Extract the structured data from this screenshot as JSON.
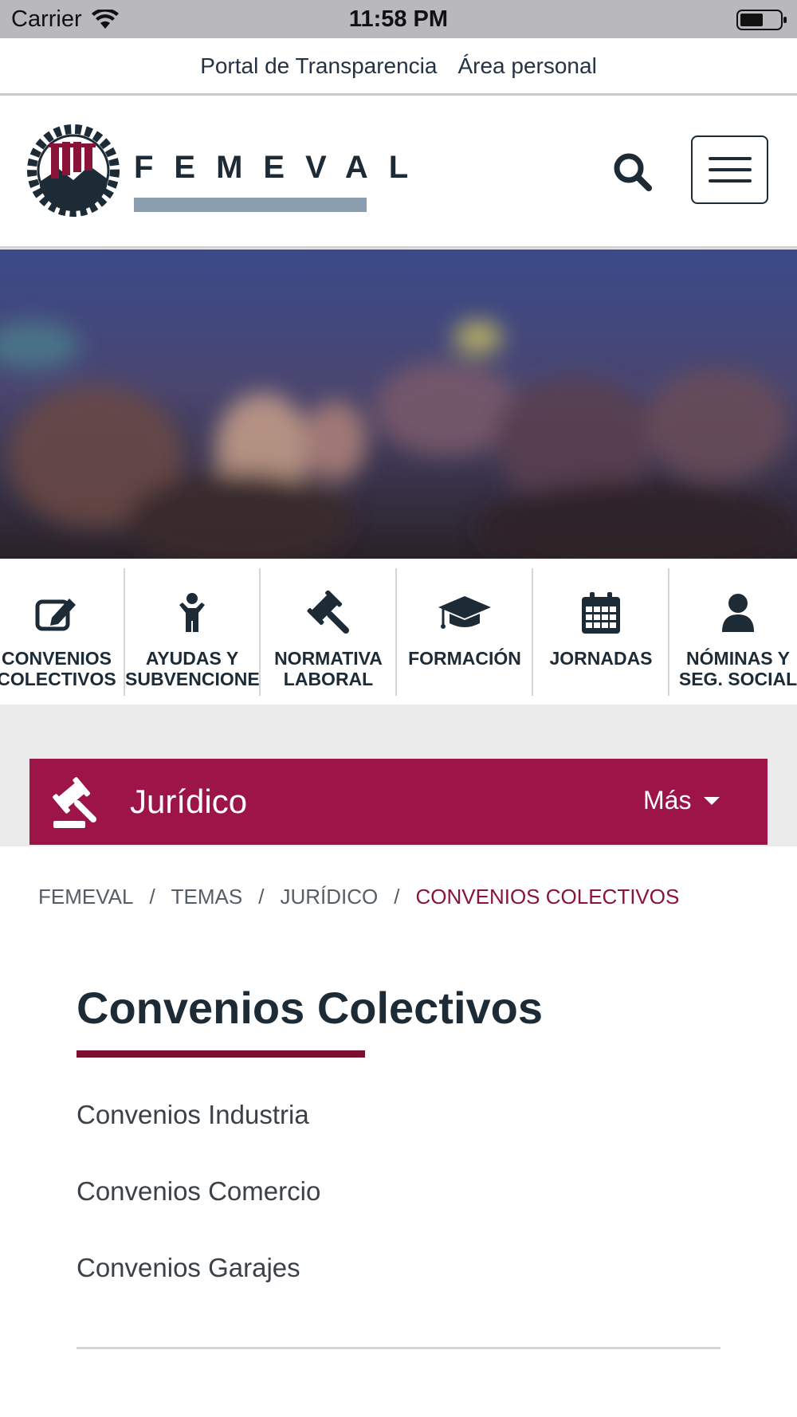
{
  "status_bar": {
    "carrier": "Carrier",
    "time": "11:58 PM"
  },
  "top_links": {
    "transparency": "Portal de Transparencia",
    "personal_area": "Área personal"
  },
  "header": {
    "logo_text": "FEMEVAL",
    "icons": [
      "search-icon",
      "hamburger-menu-icon"
    ]
  },
  "categories": [
    {
      "line1": "CONVENIOS",
      "line2": "COLECTIVOS",
      "icon": "edit-icon"
    },
    {
      "line1": "AYUDAS Y",
      "line2": "SUBVENCIONES",
      "icon": "child-icon"
    },
    {
      "line1": "NORMATIVA",
      "line2": "LABORAL",
      "icon": "gavel-icon"
    },
    {
      "line1": "FORMACIÓN",
      "line2": "",
      "icon": "graduation-cap-icon"
    },
    {
      "line1": "JORNADAS",
      "line2": "",
      "icon": "calendar-icon"
    },
    {
      "line1": "NÓMINAS Y",
      "line2": "SEG. SOCIAL",
      "icon": "user-icon"
    }
  ],
  "section_bar": {
    "title": "Jurídico",
    "more": "Más",
    "icon": "gavel-icon",
    "color": "#9c1448"
  },
  "breadcrumb": [
    "FEMEVAL",
    "TEMAS",
    "JURÍDICO",
    "CONVENIOS COLECTIVOS"
  ],
  "breadcrumb_separator": "/",
  "content": {
    "title": "Convenios Colectivos",
    "items": [
      "Convenios Industria",
      "Convenios Comercio",
      "Convenios Garajes"
    ]
  },
  "colors": {
    "brand_maroon": "#9c1448",
    "accent_rule": "#7d1030",
    "navy": "#1d2b36",
    "logo_bar": "#8b9eb0"
  }
}
